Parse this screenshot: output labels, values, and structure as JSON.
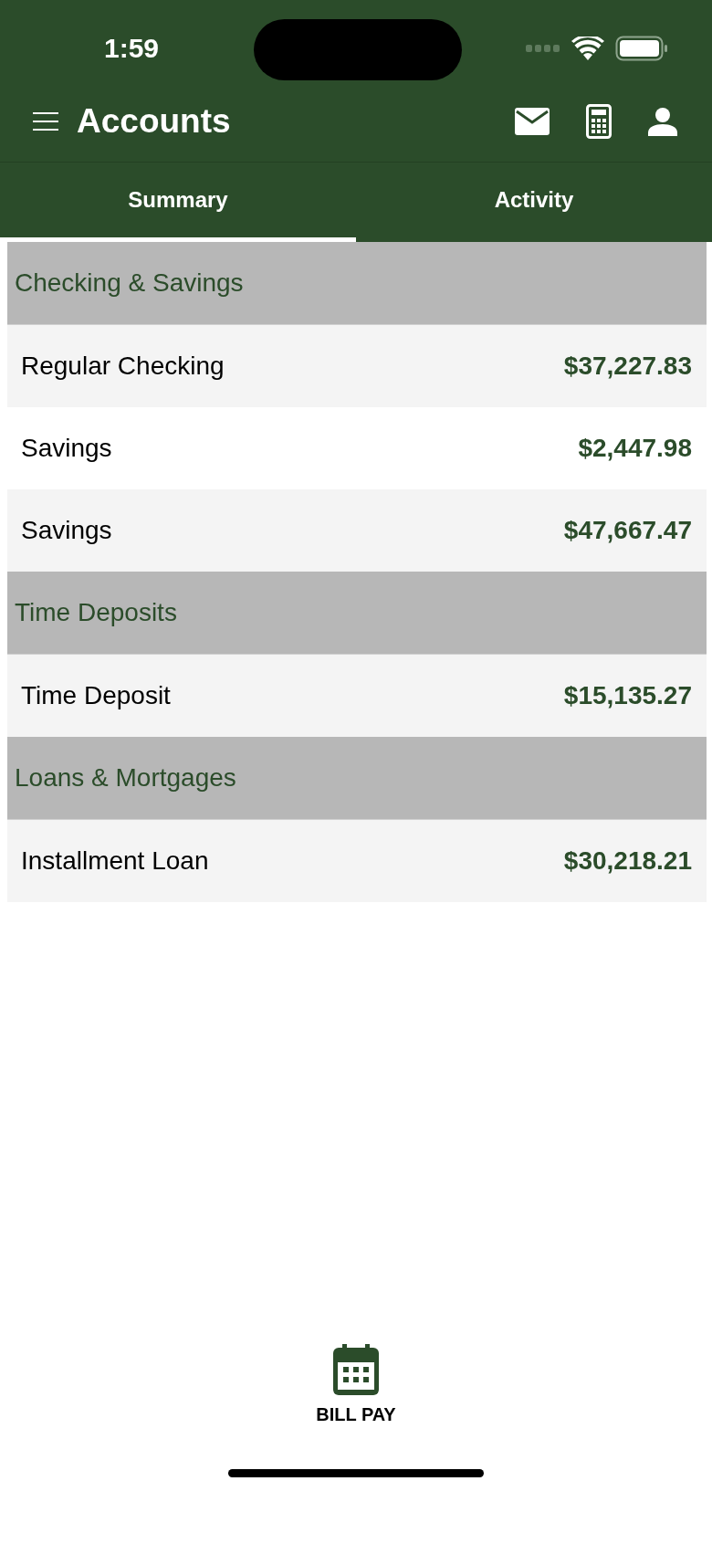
{
  "status_bar": {
    "time": "1:59"
  },
  "header": {
    "title": "Accounts"
  },
  "tabs": [
    {
      "label": "Summary",
      "selected": true
    },
    {
      "label": "Activity",
      "selected": false
    }
  ],
  "sections": [
    {
      "title": "Checking & Savings",
      "accounts": [
        {
          "name": "Regular Checking",
          "balance": "$37,227.83"
        },
        {
          "name": "Savings",
          "balance": "$2,447.98"
        },
        {
          "name": "Savings",
          "balance": "$47,667.47"
        }
      ]
    },
    {
      "title": "Time Deposits",
      "accounts": [
        {
          "name": "Time Deposit",
          "balance": "$15,135.27"
        }
      ]
    },
    {
      "title": "Loans & Mortgages",
      "accounts": [
        {
          "name": "Installment Loan",
          "balance": "$30,218.21"
        }
      ]
    }
  ],
  "bottom_action": {
    "label": "BILL PAY"
  }
}
